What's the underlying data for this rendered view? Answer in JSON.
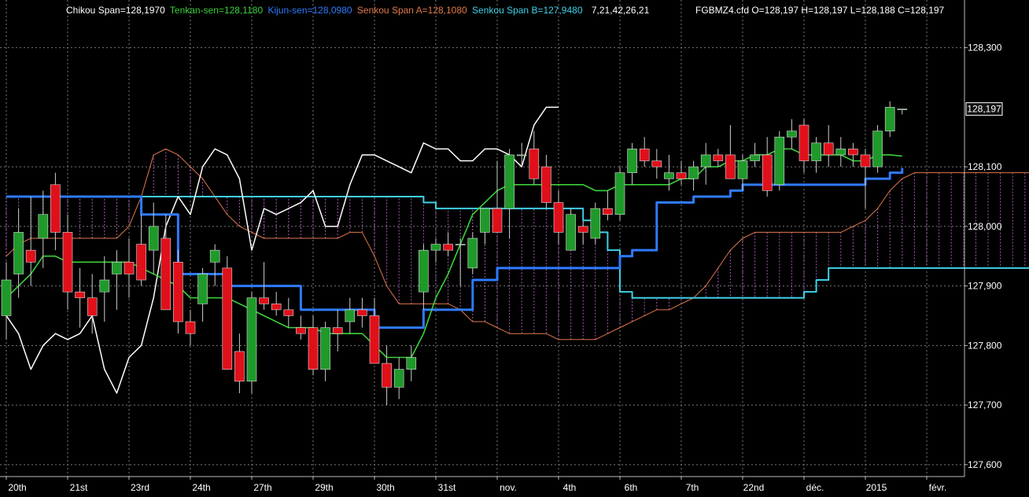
{
  "colors": {
    "background": "#000000",
    "grid": "#7a7a7a",
    "text": "#ffffff",
    "tenkan": "#3ad13a",
    "kijun": "#2f7bff",
    "senkouA": "#e0784a",
    "senkouB": "#3fd0e6",
    "chikou": "#ffffff",
    "candle_up": "#1f9a2a",
    "candle_down": "#e0101a",
    "cloud_fill": "#c86ad8"
  },
  "legend": {
    "chikou": "Chikou Span=128,1970",
    "tenkan": "Tenkan-sen=128,1180",
    "kijun": "Kijun-sen=128,0980",
    "senkouA": "Senkou Span A=128,1080",
    "senkouB": "Senkou Span B=127,9480",
    "params": "7,21,42,26,21",
    "ohlc": "FGBMZ4.cfd O=128,197 H=128,197 L=128,188 C=128,197"
  },
  "chart_data": {
    "type": "candlestick",
    "instrument": "FGBMZ4.cfd",
    "ylim": [
      127.58,
      128.38
    ],
    "y_ticks": [
      "128,300",
      "128,100",
      "128,000",
      "127,900",
      "127,800",
      "127,700",
      "127,600"
    ],
    "y_tick_values": [
      128.3,
      128.1,
      128.0,
      127.9,
      127.8,
      127.7,
      127.6
    ],
    "last_price_label": "128,197",
    "last_price": 128.197,
    "x_labels": [
      "20th",
      "21st",
      "23rd",
      "24th",
      "27th",
      "29th",
      "30th",
      "31st",
      "nov.",
      "4th",
      "6th",
      "7th",
      "22nd",
      "déc.",
      "2015",
      "févr."
    ],
    "x_label_bar_index": [
      0,
      5,
      10,
      15,
      20,
      25,
      30,
      35,
      40,
      45,
      50,
      55,
      60,
      65,
      70,
      75
    ],
    "grid": true,
    "candles": [
      {
        "o": 127.85,
        "h": 127.94,
        "l": 127.81,
        "c": 127.91
      },
      {
        "o": 127.92,
        "h": 128.03,
        "l": 127.88,
        "c": 127.99
      },
      {
        "o": 127.96,
        "h": 128.05,
        "l": 127.9,
        "c": 127.94
      },
      {
        "o": 127.98,
        "h": 128.06,
        "l": 127.93,
        "c": 128.02
      },
      {
        "o": 128.07,
        "h": 128.09,
        "l": 127.96,
        "c": 127.99
      },
      {
        "o": 127.99,
        "h": 128.02,
        "l": 127.86,
        "c": 127.89
      },
      {
        "o": 127.89,
        "h": 127.93,
        "l": 127.83,
        "c": 127.88
      },
      {
        "o": 127.88,
        "h": 127.92,
        "l": 127.82,
        "c": 127.85
      },
      {
        "o": 127.89,
        "h": 127.95,
        "l": 127.84,
        "c": 127.91
      },
      {
        "o": 127.92,
        "h": 127.96,
        "l": 127.86,
        "c": 127.94
      },
      {
        "o": 127.94,
        "h": 127.98,
        "l": 127.88,
        "c": 127.92
      },
      {
        "o": 127.97,
        "h": 128.02,
        "l": 127.9,
        "c": 127.91
      },
      {
        "o": 127.96,
        "h": 128.04,
        "l": 127.92,
        "c": 128.0
      },
      {
        "o": 127.98,
        "h": 128.02,
        "l": 127.86,
        "c": 127.86
      },
      {
        "o": 127.94,
        "h": 127.96,
        "l": 127.82,
        "c": 127.84
      },
      {
        "o": 127.84,
        "h": 127.86,
        "l": 127.8,
        "c": 127.82
      },
      {
        "o": 127.87,
        "h": 127.93,
        "l": 127.84,
        "c": 127.92
      },
      {
        "o": 127.94,
        "h": 127.97,
        "l": 127.9,
        "c": 127.96
      },
      {
        "o": 127.93,
        "h": 127.95,
        "l": 127.76,
        "c": 127.76
      },
      {
        "o": 127.79,
        "h": 127.82,
        "l": 127.72,
        "c": 127.74
      },
      {
        "o": 127.74,
        "h": 127.89,
        "l": 127.72,
        "c": 127.88
      },
      {
        "o": 127.88,
        "h": 127.94,
        "l": 127.86,
        "c": 127.87
      },
      {
        "o": 127.87,
        "h": 127.89,
        "l": 127.85,
        "c": 127.86
      },
      {
        "o": 127.86,
        "h": 127.88,
        "l": 127.83,
        "c": 127.85
      },
      {
        "o": 127.83,
        "h": 127.85,
        "l": 127.81,
        "c": 127.82
      },
      {
        "o": 127.83,
        "h": 127.85,
        "l": 127.75,
        "c": 127.76
      },
      {
        "o": 127.76,
        "h": 127.84,
        "l": 127.74,
        "c": 127.83
      },
      {
        "o": 127.83,
        "h": 127.86,
        "l": 127.79,
        "c": 127.82
      },
      {
        "o": 127.84,
        "h": 127.88,
        "l": 127.82,
        "c": 127.86
      },
      {
        "o": 127.86,
        "h": 127.88,
        "l": 127.83,
        "c": 127.85
      },
      {
        "o": 127.85,
        "h": 127.88,
        "l": 127.77,
        "c": 127.77
      },
      {
        "o": 127.77,
        "h": 127.8,
        "l": 127.7,
        "c": 127.73
      },
      {
        "o": 127.73,
        "h": 127.78,
        "l": 127.71,
        "c": 127.76
      },
      {
        "o": 127.76,
        "h": 127.8,
        "l": 127.74,
        "c": 127.78
      },
      {
        "o": 127.89,
        "h": 127.97,
        "l": 127.86,
        "c": 127.96
      },
      {
        "o": 127.96,
        "h": 127.98,
        "l": 127.94,
        "c": 127.97
      },
      {
        "o": 127.97,
        "h": 127.99,
        "l": 127.95,
        "c": 127.96
      },
      {
        "o": 127.97,
        "h": 127.98,
        "l": 127.9,
        "c": 127.97
      },
      {
        "o": 127.93,
        "h": 127.99,
        "l": 127.92,
        "c": 127.98
      },
      {
        "o": 127.99,
        "h": 128.03,
        "l": 127.97,
        "c": 128.03
      },
      {
        "o": 128.03,
        "h": 128.11,
        "l": 127.99,
        "c": 127.99
      },
      {
        "o": 128.03,
        "h": 128.13,
        "l": 127.98,
        "c": 128.12
      },
      {
        "o": 128.12,
        "h": 128.14,
        "l": 128.1,
        "c": 128.12
      },
      {
        "o": 128.13,
        "h": 128.16,
        "l": 128.07,
        "c": 128.08
      },
      {
        "o": 128.1,
        "h": 128.12,
        "l": 128.03,
        "c": 128.04
      },
      {
        "o": 128.04,
        "h": 128.06,
        "l": 127.97,
        "c": 127.99
      },
      {
        "o": 127.96,
        "h": 128.03,
        "l": 127.96,
        "c": 128.02
      },
      {
        "o": 128.0,
        "h": 128.01,
        "l": 127.97,
        "c": 127.99
      },
      {
        "o": 127.98,
        "h": 128.04,
        "l": 127.97,
        "c": 128.03
      },
      {
        "o": 128.03,
        "h": 128.06,
        "l": 128.01,
        "c": 128.02
      },
      {
        "o": 128.02,
        "h": 128.1,
        "l": 128.01,
        "c": 128.09
      },
      {
        "o": 128.09,
        "h": 128.14,
        "l": 128.07,
        "c": 128.13
      },
      {
        "o": 128.13,
        "h": 128.15,
        "l": 128.1,
        "c": 128.11
      },
      {
        "o": 128.11,
        "h": 128.13,
        "l": 128.08,
        "c": 128.1
      },
      {
        "o": 128.08,
        "h": 128.12,
        "l": 128.06,
        "c": 128.09
      },
      {
        "o": 128.09,
        "h": 128.11,
        "l": 128.07,
        "c": 128.08
      },
      {
        "o": 128.08,
        "h": 128.11,
        "l": 128.06,
        "c": 128.1
      },
      {
        "o": 128.1,
        "h": 128.14,
        "l": 128.07,
        "c": 128.12
      },
      {
        "o": 128.12,
        "h": 128.13,
        "l": 128.1,
        "c": 128.11
      },
      {
        "o": 128.12,
        "h": 128.17,
        "l": 128.08,
        "c": 128.08
      },
      {
        "o": 128.08,
        "h": 128.12,
        "l": 128.06,
        "c": 128.11
      },
      {
        "o": 128.11,
        "h": 128.14,
        "l": 128.1,
        "c": 128.12
      },
      {
        "o": 128.12,
        "h": 128.15,
        "l": 128.05,
        "c": 128.06
      },
      {
        "o": 128.07,
        "h": 128.16,
        "l": 128.06,
        "c": 128.15
      },
      {
        "o": 128.15,
        "h": 128.18,
        "l": 128.13,
        "c": 128.16
      },
      {
        "o": 128.17,
        "h": 128.18,
        "l": 128.09,
        "c": 128.11
      },
      {
        "o": 128.11,
        "h": 128.15,
        "l": 128.09,
        "c": 128.14
      },
      {
        "o": 128.14,
        "h": 128.17,
        "l": 128.1,
        "c": 128.12
      },
      {
        "o": 128.12,
        "h": 128.15,
        "l": 128.1,
        "c": 128.13
      },
      {
        "o": 128.13,
        "h": 128.14,
        "l": 128.1,
        "c": 128.12
      },
      {
        "o": 128.12,
        "h": 128.13,
        "l": 128.03,
        "c": 128.1
      },
      {
        "o": 128.1,
        "h": 128.17,
        "l": 128.09,
        "c": 128.16
      },
      {
        "o": 128.16,
        "h": 128.21,
        "l": 128.15,
        "c": 128.2
      },
      {
        "o": 128.197,
        "h": 128.197,
        "l": 128.188,
        "c": 128.197
      }
    ],
    "tenkan": [
      127.88,
      127.9,
      127.92,
      127.95,
      127.95,
      127.94,
      127.94,
      127.94,
      127.94,
      127.94,
      127.94,
      127.93,
      127.92,
      127.91,
      127.9,
      127.88,
      127.88,
      127.88,
      127.88,
      127.87,
      127.86,
      127.85,
      127.84,
      127.83,
      127.83,
      127.83,
      127.82,
      127.82,
      127.82,
      127.82,
      127.8,
      127.78,
      127.78,
      127.78,
      127.82,
      127.88,
      127.92,
      127.97,
      128.02,
      128.04,
      128.06,
      128.07,
      128.07,
      128.07,
      128.07,
      128.07,
      128.07,
      128.07,
      128.06,
      128.06,
      128.07,
      128.07,
      128.07,
      128.07,
      128.07,
      128.08,
      128.08,
      128.1,
      128.1,
      128.11,
      128.11,
      128.12,
      128.12,
      128.13,
      128.13,
      128.12,
      128.12,
      128.12,
      128.12,
      128.11,
      128.11,
      128.12,
      128.12,
      128.118
    ],
    "kijun": [
      128.05,
      128.05,
      128.05,
      128.05,
      128.05,
      128.05,
      128.05,
      128.05,
      128.05,
      128.05,
      128.05,
      128.02,
      128.02,
      128.02,
      127.92,
      127.92,
      127.92,
      127.92,
      127.9,
      127.9,
      127.9,
      127.9,
      127.9,
      127.9,
      127.86,
      127.86,
      127.86,
      127.86,
      127.86,
      127.86,
      127.83,
      127.83,
      127.83,
      127.83,
      127.86,
      127.86,
      127.86,
      127.86,
      127.91,
      127.91,
      127.93,
      127.93,
      127.93,
      127.93,
      127.93,
      127.93,
      127.93,
      127.93,
      127.93,
      127.93,
      127.95,
      127.96,
      127.96,
      128.04,
      128.04,
      128.04,
      128.05,
      128.05,
      128.05,
      128.06,
      128.07,
      128.07,
      128.07,
      128.07,
      128.07,
      128.07,
      128.07,
      128.07,
      128.07,
      128.07,
      128.08,
      128.08,
      128.09,
      128.098
    ],
    "senkouA": [
      127.95,
      127.97,
      127.98,
      127.98,
      127.98,
      127.98,
      127.98,
      127.98,
      127.98,
      127.98,
      128.0,
      128.05,
      128.12,
      128.13,
      128.12,
      128.1,
      128.08,
      128.05,
      128.02,
      128.0,
      127.99,
      127.98,
      127.98,
      127.98,
      127.98,
      127.98,
      127.98,
      127.98,
      127.99,
      127.99,
      127.95,
      127.9,
      127.87,
      127.87,
      127.87,
      127.87,
      127.87,
      127.86,
      127.84,
      127.84,
      127.83,
      127.82,
      127.82,
      127.82,
      127.82,
      127.81,
      127.81,
      127.81,
      127.81,
      127.82,
      127.83,
      127.84,
      127.85,
      127.86,
      127.86,
      127.87,
      127.88,
      127.9,
      127.93,
      127.96,
      127.98,
      127.99,
      127.99,
      127.99,
      127.99,
      127.99,
      127.99,
      127.99,
      127.99,
      128.0,
      128.01,
      128.03,
      128.06,
      128.08,
      128.09,
      128.09,
      128.09,
      128.09,
      128.09,
      128.09,
      128.09,
      128.09,
      128.09,
      128.09,
      128.09,
      128.09,
      128.09,
      128.09,
      128.09,
      128.108
    ],
    "senkouB": [
      128.05,
      128.05,
      128.05,
      128.05,
      128.05,
      128.05,
      128.05,
      128.05,
      128.05,
      128.05,
      128.05,
      128.05,
      128.05,
      128.05,
      128.05,
      128.05,
      128.05,
      128.05,
      128.05,
      128.05,
      128.05,
      128.05,
      128.05,
      128.05,
      128.05,
      128.05,
      128.05,
      128.05,
      128.05,
      128.05,
      128.05,
      128.05,
      128.05,
      128.05,
      128.04,
      128.03,
      128.03,
      128.03,
      128.03,
      128.03,
      128.03,
      128.03,
      128.03,
      128.03,
      128.03,
      128.03,
      128.03,
      128.01,
      127.99,
      127.96,
      127.89,
      127.88,
      127.88,
      127.88,
      127.88,
      127.88,
      127.88,
      127.88,
      127.88,
      127.88,
      127.88,
      127.88,
      127.88,
      127.88,
      127.88,
      127.89,
      127.91,
      127.93,
      127.93,
      127.93,
      127.93,
      127.93,
      127.93,
      127.93,
      127.93,
      127.93,
      127.93,
      127.93,
      127.93,
      127.93,
      127.93,
      127.93,
      127.93,
      127.93,
      127.93,
      127.94,
      127.94,
      127.94,
      127.94,
      127.948
    ],
    "chikou": [
      127.85,
      127.82,
      127.76,
      127.8,
      127.82,
      127.81,
      127.82,
      127.85,
      127.76,
      127.72,
      127.78,
      127.8,
      127.88,
      128.0,
      128.05,
      128.02,
      128.1,
      128.13,
      128.12,
      128.08,
      127.96,
      128.03,
      128.02,
      128.03,
      128.04,
      128.06,
      128.0,
      128.0,
      128.07,
      128.12,
      128.12,
      128.11,
      128.1,
      128.09,
      128.14,
      128.13,
      128.13,
      128.11,
      128.11,
      128.13,
      128.13,
      128.12,
      128.1,
      128.17,
      128.2,
      128.2
    ]
  }
}
